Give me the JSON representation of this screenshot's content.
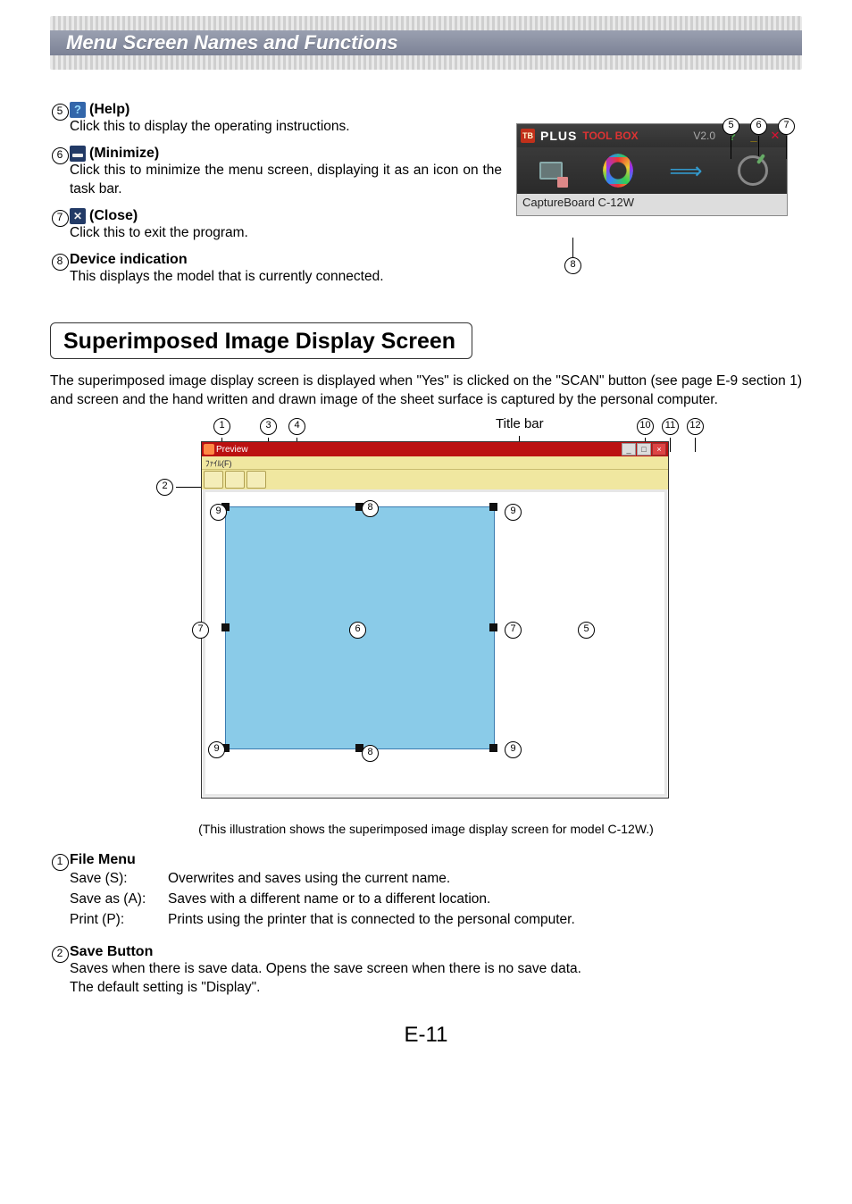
{
  "banner": {
    "title": "Menu Screen Names and Functions"
  },
  "items_top": {
    "n5": {
      "title": "(Help)",
      "desc": "Click this to display the operating instructions."
    },
    "n6": {
      "title": "(Minimize)",
      "desc": "Click this to minimize the menu screen, displaying it as an icon on the task bar."
    },
    "n7": {
      "title": "(Close)",
      "desc": "Click this to exit the program."
    },
    "n8": {
      "title": "Device indication",
      "desc": "This displays the model that is currently connected."
    }
  },
  "toolbox": {
    "plus": "PLUS",
    "tbx": "TOOL BOX",
    "version": "V2.0",
    "status": "CaptureBoard C-12W"
  },
  "section2": {
    "title": "Superimposed Image Display Screen",
    "para": "The superimposed image display screen is displayed when \"Yes\" is clicked on the \"SCAN\" button (see page E-9 section 1) and screen and the hand written and drawn image of the sheet surface is captured by the personal computer.",
    "titlebar_label": "Title bar",
    "preview_label": "Preview",
    "menu_label": "ﾌｧｲﾙ(F)",
    "caption": "(This illustration shows the superimposed image display screen for model C-12W.)"
  },
  "items_bottom": {
    "n1": {
      "title": "File Menu",
      "rows": [
        {
          "k": "Save (S):",
          "v": "Overwrites and saves using the current name."
        },
        {
          "k": "Save as (A):",
          "v": "Saves with a different name or to a different location."
        },
        {
          "k": "Print (P):",
          "v": "Prints using the printer that is connected to the personal computer."
        }
      ]
    },
    "n2": {
      "title": "Save Button",
      "desc1": "Saves when there is save data. Opens the save screen when there is no save data.",
      "desc2": "The default setting is \"Display\"."
    }
  },
  "page_number": "E-11"
}
